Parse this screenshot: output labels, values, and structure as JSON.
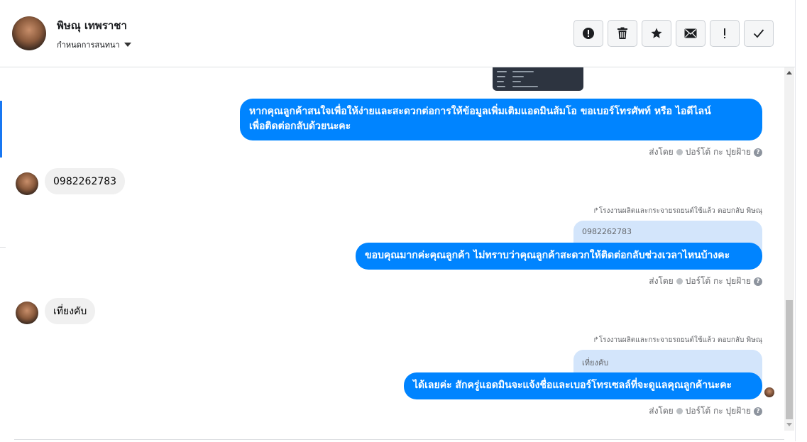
{
  "header": {
    "contact_name": "พิษณุ เทพราชา",
    "conversation_settings": "กำหนดการสนทนา",
    "actions": [
      {
        "name": "report-button",
        "icon": "exclamation-circle-icon"
      },
      {
        "name": "delete-button",
        "icon": "trash-icon"
      },
      {
        "name": "star-button",
        "icon": "star-icon"
      },
      {
        "name": "mark-unread-button",
        "icon": "envelope-icon"
      },
      {
        "name": "important-button",
        "icon": "exclamation-icon"
      },
      {
        "name": "done-button",
        "icon": "check-icon"
      }
    ]
  },
  "messages": [
    {
      "type": "outgoing",
      "text_line1": "หากคุณลูกค้าสนใจเพื่อให้ง่ายและสะดวกต่อการให้ข้อมูลเพิ่มเติมแอดมินส้มโอ ขอเบอร์โทรศัพท์ หรือ ไอดีไลน์",
      "text_line2": "เพื่อติดต่อกลับด้วยนะคะ",
      "sent_by": "ส่งโดย",
      "sender": "ปอร์โต้ กะ ปุยฝ้าย"
    },
    {
      "type": "incoming",
      "text": "0982262783"
    },
    {
      "type": "outgoing_reply",
      "reply_note": "โรงงานผลิตและกระจายรถยนต์ใช้แล้ว ตอบกลับ พิษณุ",
      "quoted": "0982262783",
      "text": "ขอบคุณมากค่ะคุณลูกค้า ไม่ทราบว่าคุณลูกค้าสะดวกให้ติดต่อกลับช่วงเวลาไหนบ้างคะ",
      "sent_by": "ส่งโดย",
      "sender": "ปอร์โต้ กะ ปุยฝ้าย"
    },
    {
      "type": "incoming",
      "text": "เที่ยงคับ"
    },
    {
      "type": "outgoing_reply",
      "reply_note": "โรงงานผลิตและกระจายรถยนต์ใช้แล้ว ตอบกลับ พิษณุ",
      "quoted": "เที่ยงคับ",
      "text": "ได้เลยค่ะ สักครู่แอดมินจะแจ้งชื่อและเบอร์โทรเซลล์ที่จะดูแลคุณลูกค้านะคะ",
      "sent_by": "ส่งโดย",
      "sender": "ปอร์โต้ กะ ปุยฝ้าย"
    }
  ],
  "colors": {
    "outgoing_bubble": "#0084ff",
    "incoming_bubble": "#f0f0f0",
    "quote_bubble": "#d3e5fb",
    "accent": "#1877f2"
  }
}
